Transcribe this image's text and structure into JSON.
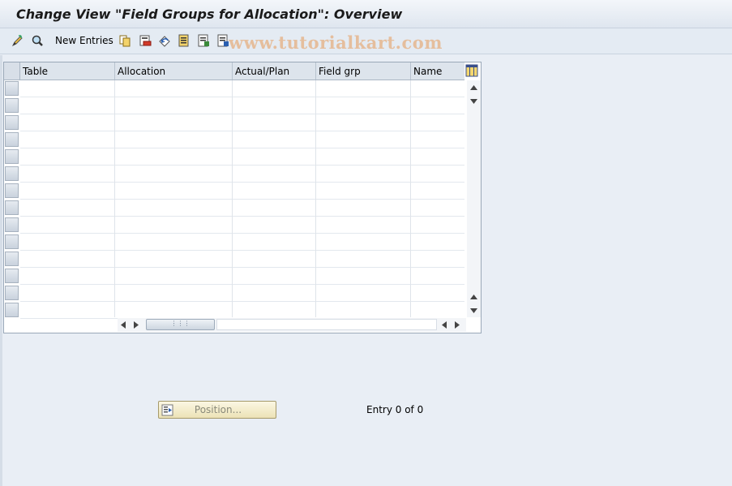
{
  "window": {
    "title": "Change View \"Field Groups for Allocation\": Overview"
  },
  "toolbar": {
    "new_entries_label": "New Entries",
    "watermark": "www.tutorialkart.com",
    "icons": [
      "display-change-icon",
      "find-icon",
      "copy-icon",
      "delete-icon",
      "undo-icon",
      "select-all-icon",
      "select-block-icon",
      "deselect-all-icon"
    ]
  },
  "table": {
    "columns": [
      "Table",
      "Allocation",
      "Actual/Plan",
      "Field grp",
      "Name"
    ],
    "row_count": 14,
    "rows": []
  },
  "footer": {
    "position_button_label": "Position...",
    "entry_text": "Entry 0 of 0"
  },
  "colors": {
    "background": "#e9eef5",
    "title_bar": "#dfe6ef",
    "position_button": "#ece2b6"
  }
}
